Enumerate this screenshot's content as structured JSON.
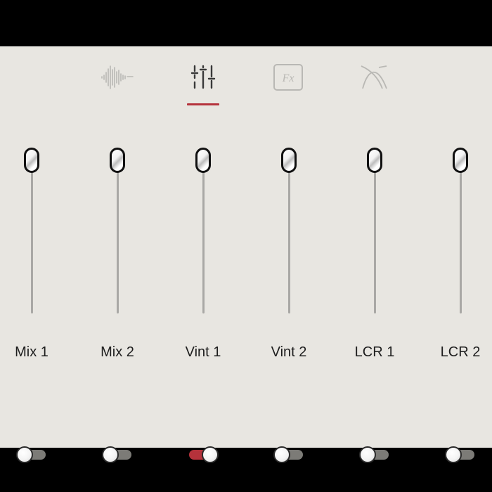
{
  "tabs": [
    {
      "id": "waveform",
      "icon": "waveform-icon",
      "active": false
    },
    {
      "id": "mixer",
      "icon": "mixer-sliders-icon",
      "active": true
    },
    {
      "id": "fx",
      "icon": "fx-icon",
      "label": "Fx",
      "active": false
    },
    {
      "id": "curves",
      "icon": "crossfade-curve-icon",
      "active": false
    }
  ],
  "channels": [
    {
      "label": "Mix 1",
      "enabled": false
    },
    {
      "label": "Mix 2",
      "enabled": false
    },
    {
      "label": "Vint 1",
      "enabled": true
    },
    {
      "label": "Vint 2",
      "enabled": false
    },
    {
      "label": "LCR 1",
      "enabled": false
    },
    {
      "label": "LCR 2",
      "enabled": false
    }
  ],
  "fader_level": 1.0,
  "colors": {
    "accent": "#b5323b",
    "panel": "#e8e6e1",
    "frame": "#000000",
    "track": "#a9a8a5",
    "toggle_off": "#7c7b77"
  }
}
